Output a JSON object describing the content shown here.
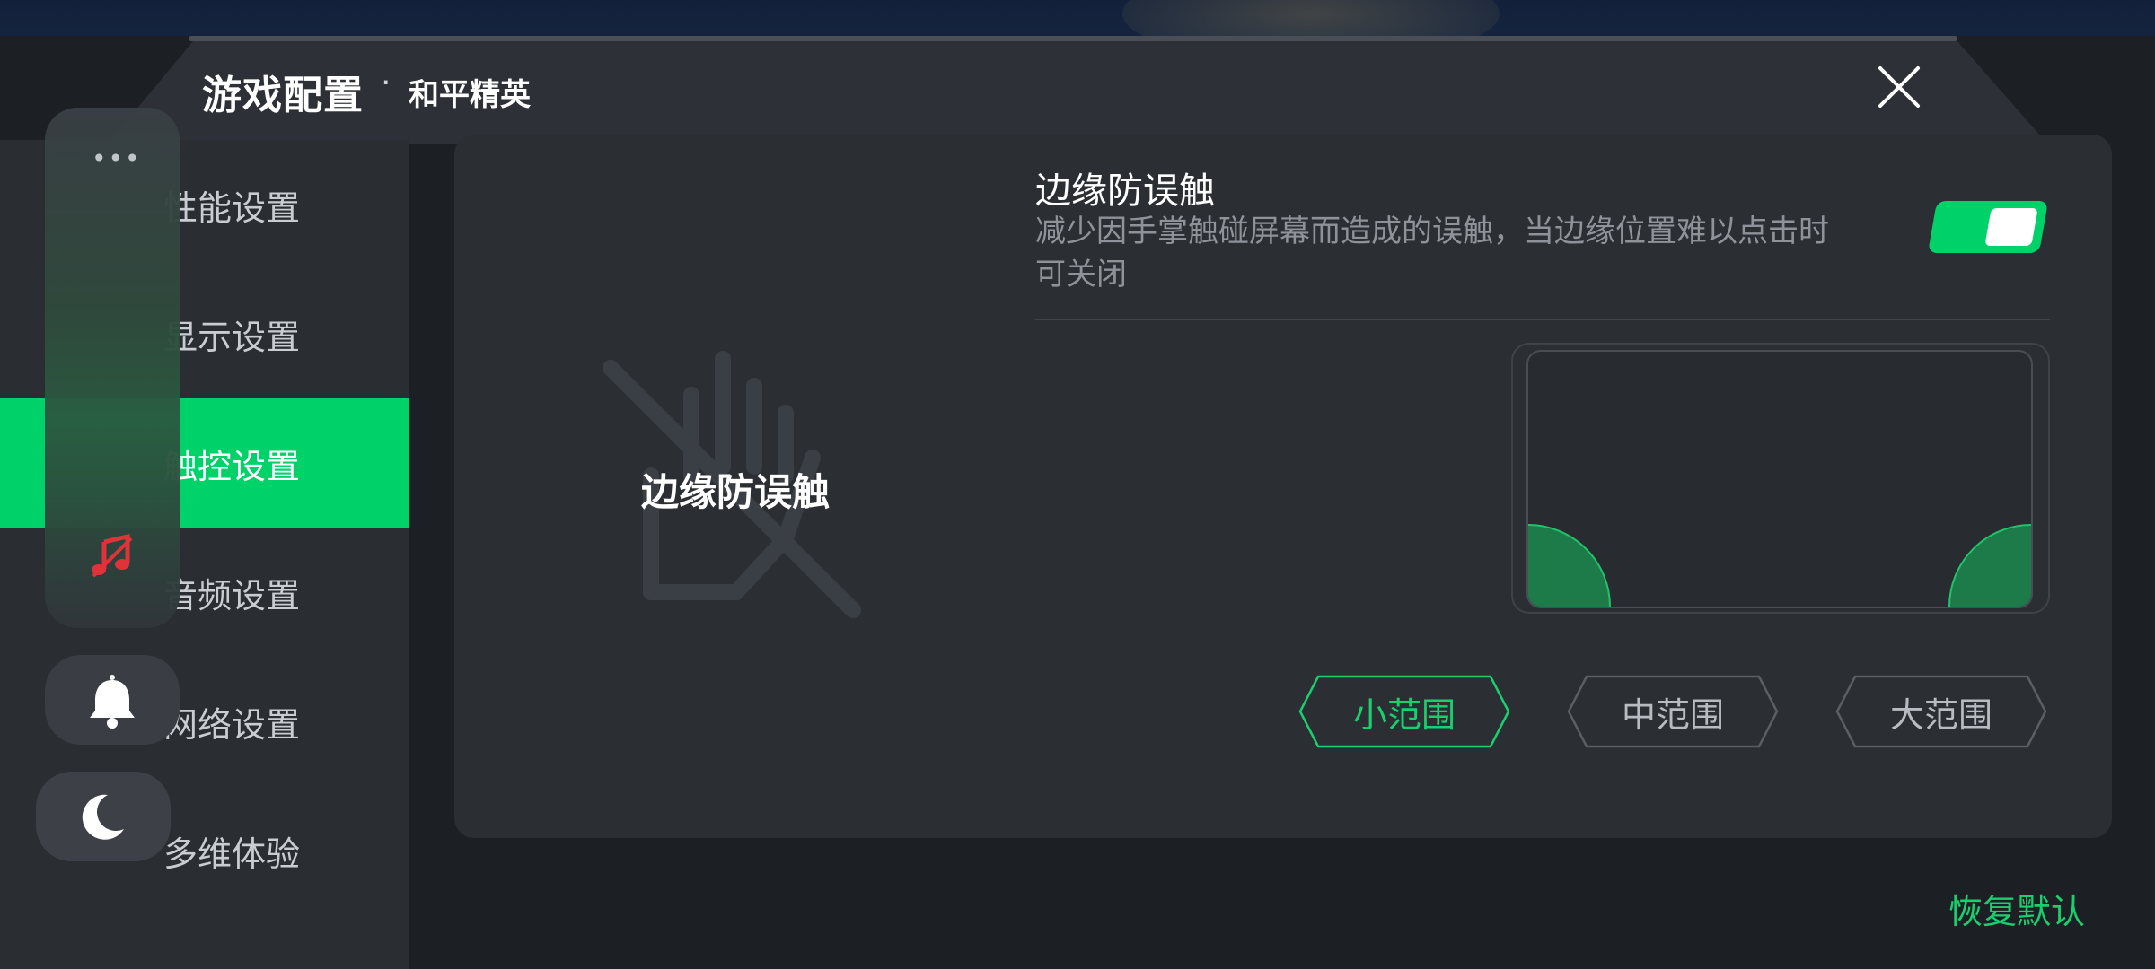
{
  "header": {
    "title": "游戏配置",
    "separator": "·",
    "subtitle": "和平精英",
    "close_icon": "close-icon"
  },
  "sidebar": {
    "items": [
      {
        "label": "性能设置",
        "active": false
      },
      {
        "label": "显示设置",
        "active": false
      },
      {
        "label": "触控设置",
        "active": true
      },
      {
        "label": "音频设置",
        "active": false
      },
      {
        "label": "网络设置",
        "active": false
      },
      {
        "label": "多维体验",
        "active": false
      }
    ]
  },
  "float_panel": {
    "menu_icon": "more-dots-icon",
    "dots": "•••",
    "music_icon": "music-off-icon",
    "bell_icon": "bell-icon",
    "moon_icon": "moon-icon"
  },
  "content": {
    "hero_label": "边缘防误触",
    "hero_icon": "hand-off-icon",
    "setting": {
      "title": "边缘防误触",
      "description": "减少因手掌触碰屏幕而造成的误触，当边缘位置难以点击时可关闭",
      "enabled": true
    },
    "range_options": [
      {
        "label": "小范围",
        "selected": true
      },
      {
        "label": "中范围",
        "selected": false
      },
      {
        "label": "大范围",
        "selected": false
      }
    ]
  },
  "footer": {
    "restore_label": "恢复默认"
  },
  "colors": {
    "accent": "#00d26a",
    "panel_bg": "#2b2f34",
    "sidebar_bg": "#2a2e33",
    "muted_text": "#8e939a"
  }
}
